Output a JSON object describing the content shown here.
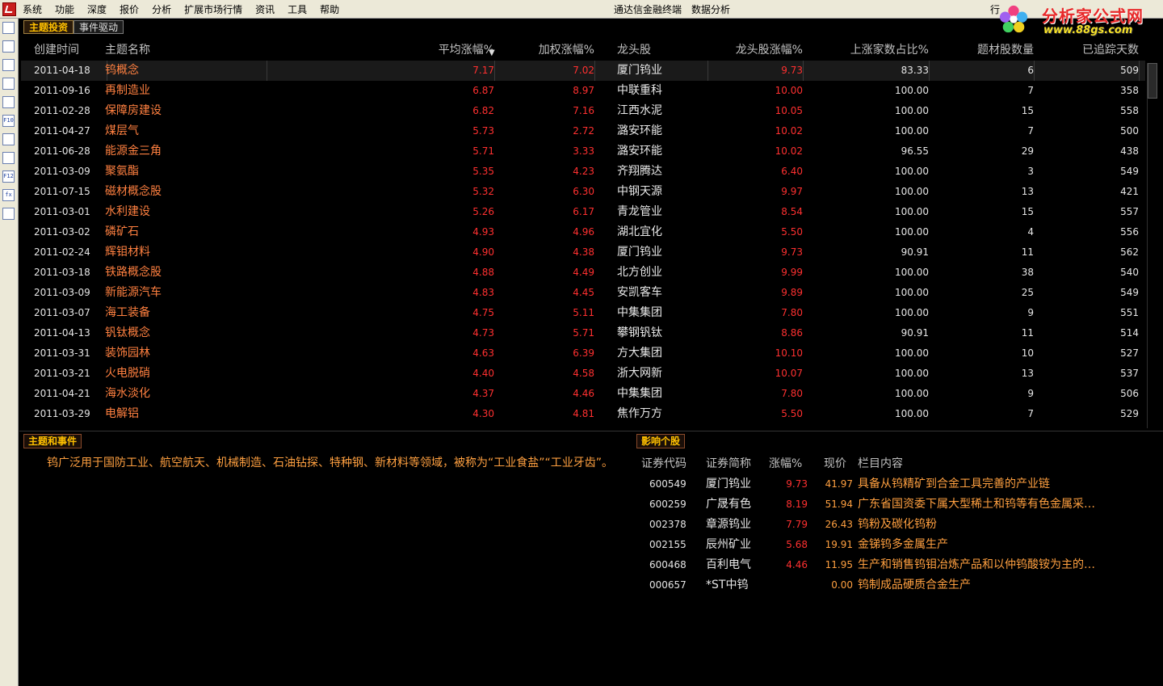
{
  "menu": {
    "items": [
      "系统",
      "功能",
      "深度",
      "报价",
      "分析",
      "扩展市场行情",
      "资讯",
      "工具",
      "帮助"
    ],
    "center_titles": [
      "通达信金融终端",
      "数据分析"
    ],
    "right_item": "行"
  },
  "watermark": {
    "title": "分析家公式网",
    "url": "www.88gs.com"
  },
  "left_toolbar": {
    "icons": [
      "chart-list-icon",
      "grid-table-icon",
      "line-chart-icon",
      "candlestick-icon",
      "news-icon",
      "f10-icon",
      "notes-icon",
      "calendar-icon",
      "f12-icon",
      "formula-icon",
      "search-icon"
    ],
    "labels": [
      "",
      "",
      "",
      "",
      "",
      "F10",
      "",
      "",
      "F12",
      "fx",
      ""
    ]
  },
  "tabs": [
    {
      "label": "主题投资",
      "active": true
    },
    {
      "label": "事件驱动",
      "active": false
    }
  ],
  "table": {
    "headers": {
      "date": "创建时间",
      "name": "主题名称",
      "avg": "平均涨幅%",
      "weighted": "加权涨幅%",
      "leader": "龙头股",
      "leader_chg": "龙头股涨幅%",
      "up_ratio": "上涨家数占比%",
      "count": "题材股数量",
      "days": "已追踪天数"
    },
    "rows": [
      {
        "date": "2011-04-18",
        "name": "钨概念",
        "avg": "7.17",
        "weighted": "7.02",
        "leader": "厦门钨业",
        "leader_chg": "9.73",
        "up_ratio": "83.33",
        "count": "6",
        "days": "509"
      },
      {
        "date": "2011-09-16",
        "name": "再制造业",
        "avg": "6.87",
        "weighted": "8.97",
        "leader": "中联重科",
        "leader_chg": "10.00",
        "up_ratio": "100.00",
        "count": "7",
        "days": "358"
      },
      {
        "date": "2011-02-28",
        "name": "保障房建设",
        "avg": "6.82",
        "weighted": "7.16",
        "leader": "江西水泥",
        "leader_chg": "10.05",
        "up_ratio": "100.00",
        "count": "15",
        "days": "558"
      },
      {
        "date": "2011-04-27",
        "name": "煤层气",
        "avg": "5.73",
        "weighted": "2.72",
        "leader": "潞安环能",
        "leader_chg": "10.02",
        "up_ratio": "100.00",
        "count": "7",
        "days": "500"
      },
      {
        "date": "2011-06-28",
        "name": "能源金三角",
        "avg": "5.71",
        "weighted": "3.33",
        "leader": "潞安环能",
        "leader_chg": "10.02",
        "up_ratio": "96.55",
        "count": "29",
        "days": "438"
      },
      {
        "date": "2011-03-09",
        "name": "聚氨酯",
        "avg": "5.35",
        "weighted": "4.23",
        "leader": "齐翔腾达",
        "leader_chg": "6.40",
        "up_ratio": "100.00",
        "count": "3",
        "days": "549"
      },
      {
        "date": "2011-07-15",
        "name": "磁材概念股",
        "avg": "5.32",
        "weighted": "6.30",
        "leader": "中钢天源",
        "leader_chg": "9.97",
        "up_ratio": "100.00",
        "count": "13",
        "days": "421"
      },
      {
        "date": "2011-03-01",
        "name": "水利建设",
        "avg": "5.26",
        "weighted": "6.17",
        "leader": "青龙管业",
        "leader_chg": "8.54",
        "up_ratio": "100.00",
        "count": "15",
        "days": "557"
      },
      {
        "date": "2011-03-02",
        "name": "磷矿石",
        "avg": "4.93",
        "weighted": "4.96",
        "leader": "湖北宜化",
        "leader_chg": "5.50",
        "up_ratio": "100.00",
        "count": "4",
        "days": "556"
      },
      {
        "date": "2011-02-24",
        "name": "辉钼材料",
        "avg": "4.90",
        "weighted": "4.38",
        "leader": "厦门钨业",
        "leader_chg": "9.73",
        "up_ratio": "90.91",
        "count": "11",
        "days": "562"
      },
      {
        "date": "2011-03-18",
        "name": "铁路概念股",
        "avg": "4.88",
        "weighted": "4.49",
        "leader": "北方创业",
        "leader_chg": "9.99",
        "up_ratio": "100.00",
        "count": "38",
        "days": "540"
      },
      {
        "date": "2011-03-09",
        "name": "新能源汽车",
        "avg": "4.83",
        "weighted": "4.45",
        "leader": "安凯客车",
        "leader_chg": "9.89",
        "up_ratio": "100.00",
        "count": "25",
        "days": "549"
      },
      {
        "date": "2011-03-07",
        "name": "海工装备",
        "avg": "4.75",
        "weighted": "5.11",
        "leader": "中集集团",
        "leader_chg": "7.80",
        "up_ratio": "100.00",
        "count": "9",
        "days": "551"
      },
      {
        "date": "2011-04-13",
        "name": "钒钛概念",
        "avg": "4.73",
        "weighted": "5.71",
        "leader": "攀钢钒钛",
        "leader_chg": "8.86",
        "up_ratio": "90.91",
        "count": "11",
        "days": "514"
      },
      {
        "date": "2011-03-31",
        "name": "装饰园林",
        "avg": "4.63",
        "weighted": "6.39",
        "leader": "方大集团",
        "leader_chg": "10.10",
        "up_ratio": "100.00",
        "count": "10",
        "days": "527"
      },
      {
        "date": "2011-03-21",
        "name": "火电脱硝",
        "avg": "4.40",
        "weighted": "4.58",
        "leader": "浙大网新",
        "leader_chg": "10.07",
        "up_ratio": "100.00",
        "count": "13",
        "days": "537"
      },
      {
        "date": "2011-04-21",
        "name": "海水淡化",
        "avg": "4.37",
        "weighted": "4.46",
        "leader": "中集集团",
        "leader_chg": "7.80",
        "up_ratio": "100.00",
        "count": "9",
        "days": "506"
      },
      {
        "date": "2011-03-29",
        "name": "电解铝",
        "avg": "4.30",
        "weighted": "4.81",
        "leader": "焦作万方",
        "leader_chg": "5.50",
        "up_ratio": "100.00",
        "count": "7",
        "days": "529"
      }
    ]
  },
  "theme_section": {
    "label": "主题和事件",
    "text": "钨广泛用于国防工业、航空航天、机械制造、石油钻探、特种钢、新材料等领域，被称为“工业食盐”“工业牙齿”。"
  },
  "stocks_section": {
    "label": "影响个股",
    "headers": {
      "code": "证券代码",
      "name": "证券简称",
      "chg": "涨幅%",
      "price": "现价",
      "content": "栏目内容"
    },
    "rows": [
      {
        "code": "600549",
        "name": "厦门钨业",
        "chg": "9.73",
        "price": "41.97",
        "content": "具备从钨精矿到合金工具完善的产业链"
      },
      {
        "code": "600259",
        "name": "广晟有色",
        "chg": "8.19",
        "price": "51.94",
        "content": "广东省国资委下属大型稀土和钨等有色金属采…"
      },
      {
        "code": "002378",
        "name": "章源钨业",
        "chg": "7.79",
        "price": "26.43",
        "content": "钨粉及碳化钨粉"
      },
      {
        "code": "002155",
        "name": "辰州矿业",
        "chg": "5.68",
        "price": "19.91",
        "content": "金锑钨多金属生产"
      },
      {
        "code": "600468",
        "name": "百利电气",
        "chg": "4.46",
        "price": "11.95",
        "content": "生产和销售钨钼冶炼产品和以仲钨酸铵为主的…"
      },
      {
        "code": "000657",
        "name": "*ST中钨",
        "chg": "",
        "price": "0.00",
        "content": "钨制成品硬质合金生产"
      }
    ]
  },
  "colors": {
    "up_red": "#ff3030",
    "theme_orange": "#ff8040",
    "label_gold": "#ffc000"
  }
}
